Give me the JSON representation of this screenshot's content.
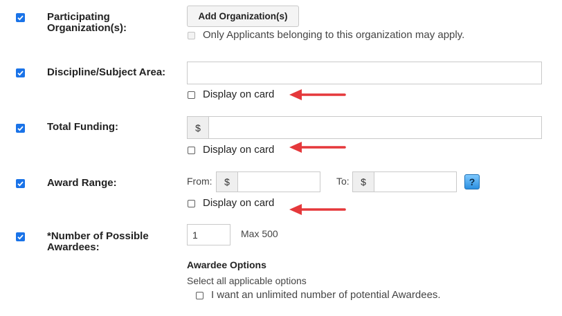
{
  "rows": {
    "participating": {
      "checked": true,
      "label_line1": "Participating",
      "label_line2": "Organization(s):",
      "add_button": "Add Organization(s)",
      "restrict_option": "Only Applicants belonging to this organization may apply."
    },
    "discipline": {
      "checked": true,
      "label": "Discipline/Subject Area:",
      "value": "",
      "display_on_card": "Display on card"
    },
    "funding": {
      "checked": true,
      "label": "Total Funding:",
      "currency": "$",
      "value": "",
      "display_on_card": "Display on card"
    },
    "award_range": {
      "checked": true,
      "label": "Award Range:",
      "from_label": "From:",
      "to_label": "To:",
      "currency": "$",
      "from_value": "",
      "to_value": "",
      "help": "?",
      "display_on_card": "Display on card"
    },
    "awardees": {
      "checked": true,
      "label_line1": "*Number of Possible",
      "label_line2": "Awardees:",
      "value": "1",
      "max_text": "Max 500",
      "options_heading": "Awardee Options",
      "options_hint": "Select all applicable options",
      "unlimited_option": "I want an unlimited number of potential Awardees."
    }
  },
  "colors": {
    "row_checkbox": "#1a73e8",
    "annotation_arrow": "#e5383b",
    "help_button": "#2b8fe0"
  },
  "icons": {
    "row_checkbox": "checkmark-icon",
    "annotation": "arrow-left-icon",
    "help": "question-mark-icon"
  }
}
